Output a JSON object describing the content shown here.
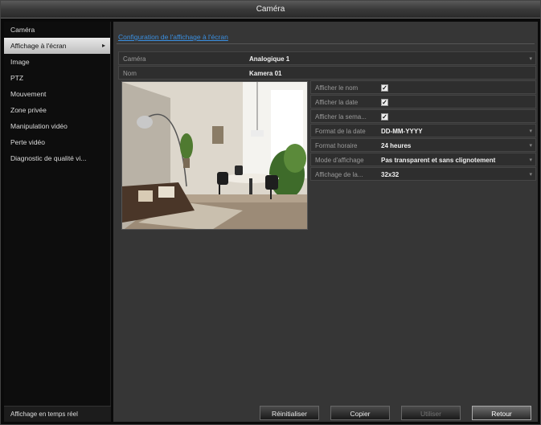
{
  "window": {
    "title": "Caméra"
  },
  "sidebar": {
    "items": [
      {
        "label": "Caméra"
      },
      {
        "label": "Affichage à l'écran",
        "arrow": "▸"
      },
      {
        "label": "Image"
      },
      {
        "label": "PTZ"
      },
      {
        "label": "Mouvement"
      },
      {
        "label": "Zone privée"
      },
      {
        "label": "Manipulation vidéo"
      },
      {
        "label": "Perte vidéo"
      },
      {
        "label": "Diagnostic de qualité vi..."
      }
    ],
    "bottom_label": "Affichage en temps réel"
  },
  "main": {
    "section_title": "Configuration de l'affichage à l'écran",
    "camera": {
      "label": "Caméra",
      "value": "Analogique 1"
    },
    "name": {
      "label": "Nom",
      "value": "Kamera 01"
    },
    "settings": [
      {
        "label": "Afficher le nom",
        "type": "checkbox",
        "checked": true
      },
      {
        "label": "Afficher la date",
        "type": "checkbox",
        "checked": true
      },
      {
        "label": "Afficher la sema...",
        "type": "checkbox",
        "checked": true
      },
      {
        "label": "Format de la date",
        "type": "select",
        "value": "DD-MM-YYYY"
      },
      {
        "label": "Format horaire",
        "type": "select",
        "value": "24 heures"
      },
      {
        "label": "Mode d'affichage",
        "type": "select",
        "value": "Pas transparent et sans clignotement"
      },
      {
        "label": "Affichage de la...",
        "type": "select",
        "value": "32x32"
      }
    ]
  },
  "buttons": {
    "reset": "Réinitialiser",
    "copy": "Copier",
    "apply": "Utiliser",
    "back": "Retour"
  },
  "icons": {
    "checkbox": "check-icon",
    "dropdown": "chevron-down-icon"
  },
  "colors": {
    "accent_link": "#3a8fe0",
    "panel": "#363636",
    "background": "#0a0a0a"
  }
}
